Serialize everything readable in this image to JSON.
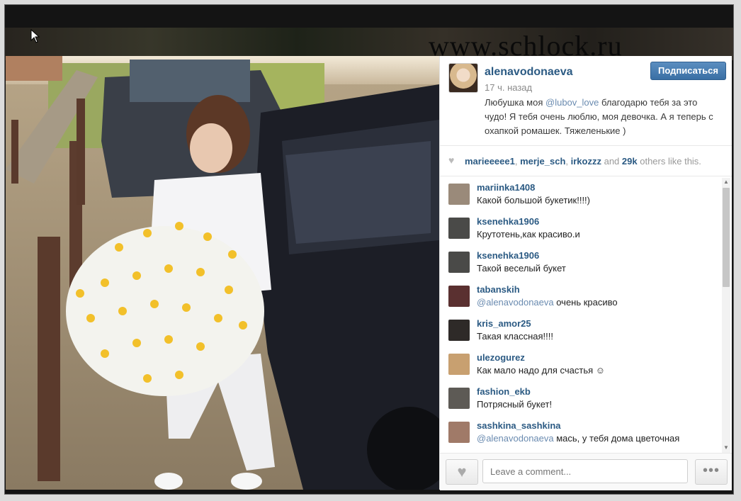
{
  "watermark": "www.schlock.ru",
  "post": {
    "username": "alenavodonaeva",
    "follow_label": "Подписаться",
    "time_ago": "17 ч. назад",
    "caption_pre": "Любушка моя ",
    "caption_mention": "@lubov_love",
    "caption_post": " благодарю тебя за это чудо! Я тебя очень люблю, моя девочка. А я теперь с охапкой ромашек. Тяжеленькие )"
  },
  "likes": {
    "user1": "marieeeee1",
    "sep1": ", ",
    "user2": "merje_sch",
    "sep2": ", ",
    "user3": "irkozzz",
    "and": " and ",
    "count": "29k",
    "suffix": " others like this."
  },
  "comments": [
    {
      "name": "mariinka1408",
      "text": "Какой большой букетик!!!!)",
      "avatar_color": "#9a8a7a"
    },
    {
      "name": "ksenehka1906",
      "text": "Крутотень,как красиво.и",
      "avatar_color": "#4a4a48"
    },
    {
      "name": "ksenehka1906",
      "text": "Такой веселый букет",
      "avatar_color": "#4a4a48"
    },
    {
      "name": "tabanskih",
      "mention": "@alenavodonaeva",
      "text": " очень красиво",
      "avatar_color": "#5a3030"
    },
    {
      "name": "kris_amor25",
      "text": "Такая классная!!!!",
      "avatar_color": "#2e2a28"
    },
    {
      "name": "ulezogurez",
      "text": "Как мало надо для счастья ☺",
      "avatar_color": "#c8a070"
    },
    {
      "name": "fashion_ekb",
      "text": "Потрясный букет!",
      "avatar_color": "#5d5a55"
    },
    {
      "name": "sashkina_sashkina",
      "mention": "@alenavodonaeva",
      "text": " мась, у тебя дома цветочная",
      "avatar_color": "#a07a68"
    }
  ],
  "footer": {
    "comment_placeholder": "Leave a comment...",
    "more_label": "•••"
  }
}
